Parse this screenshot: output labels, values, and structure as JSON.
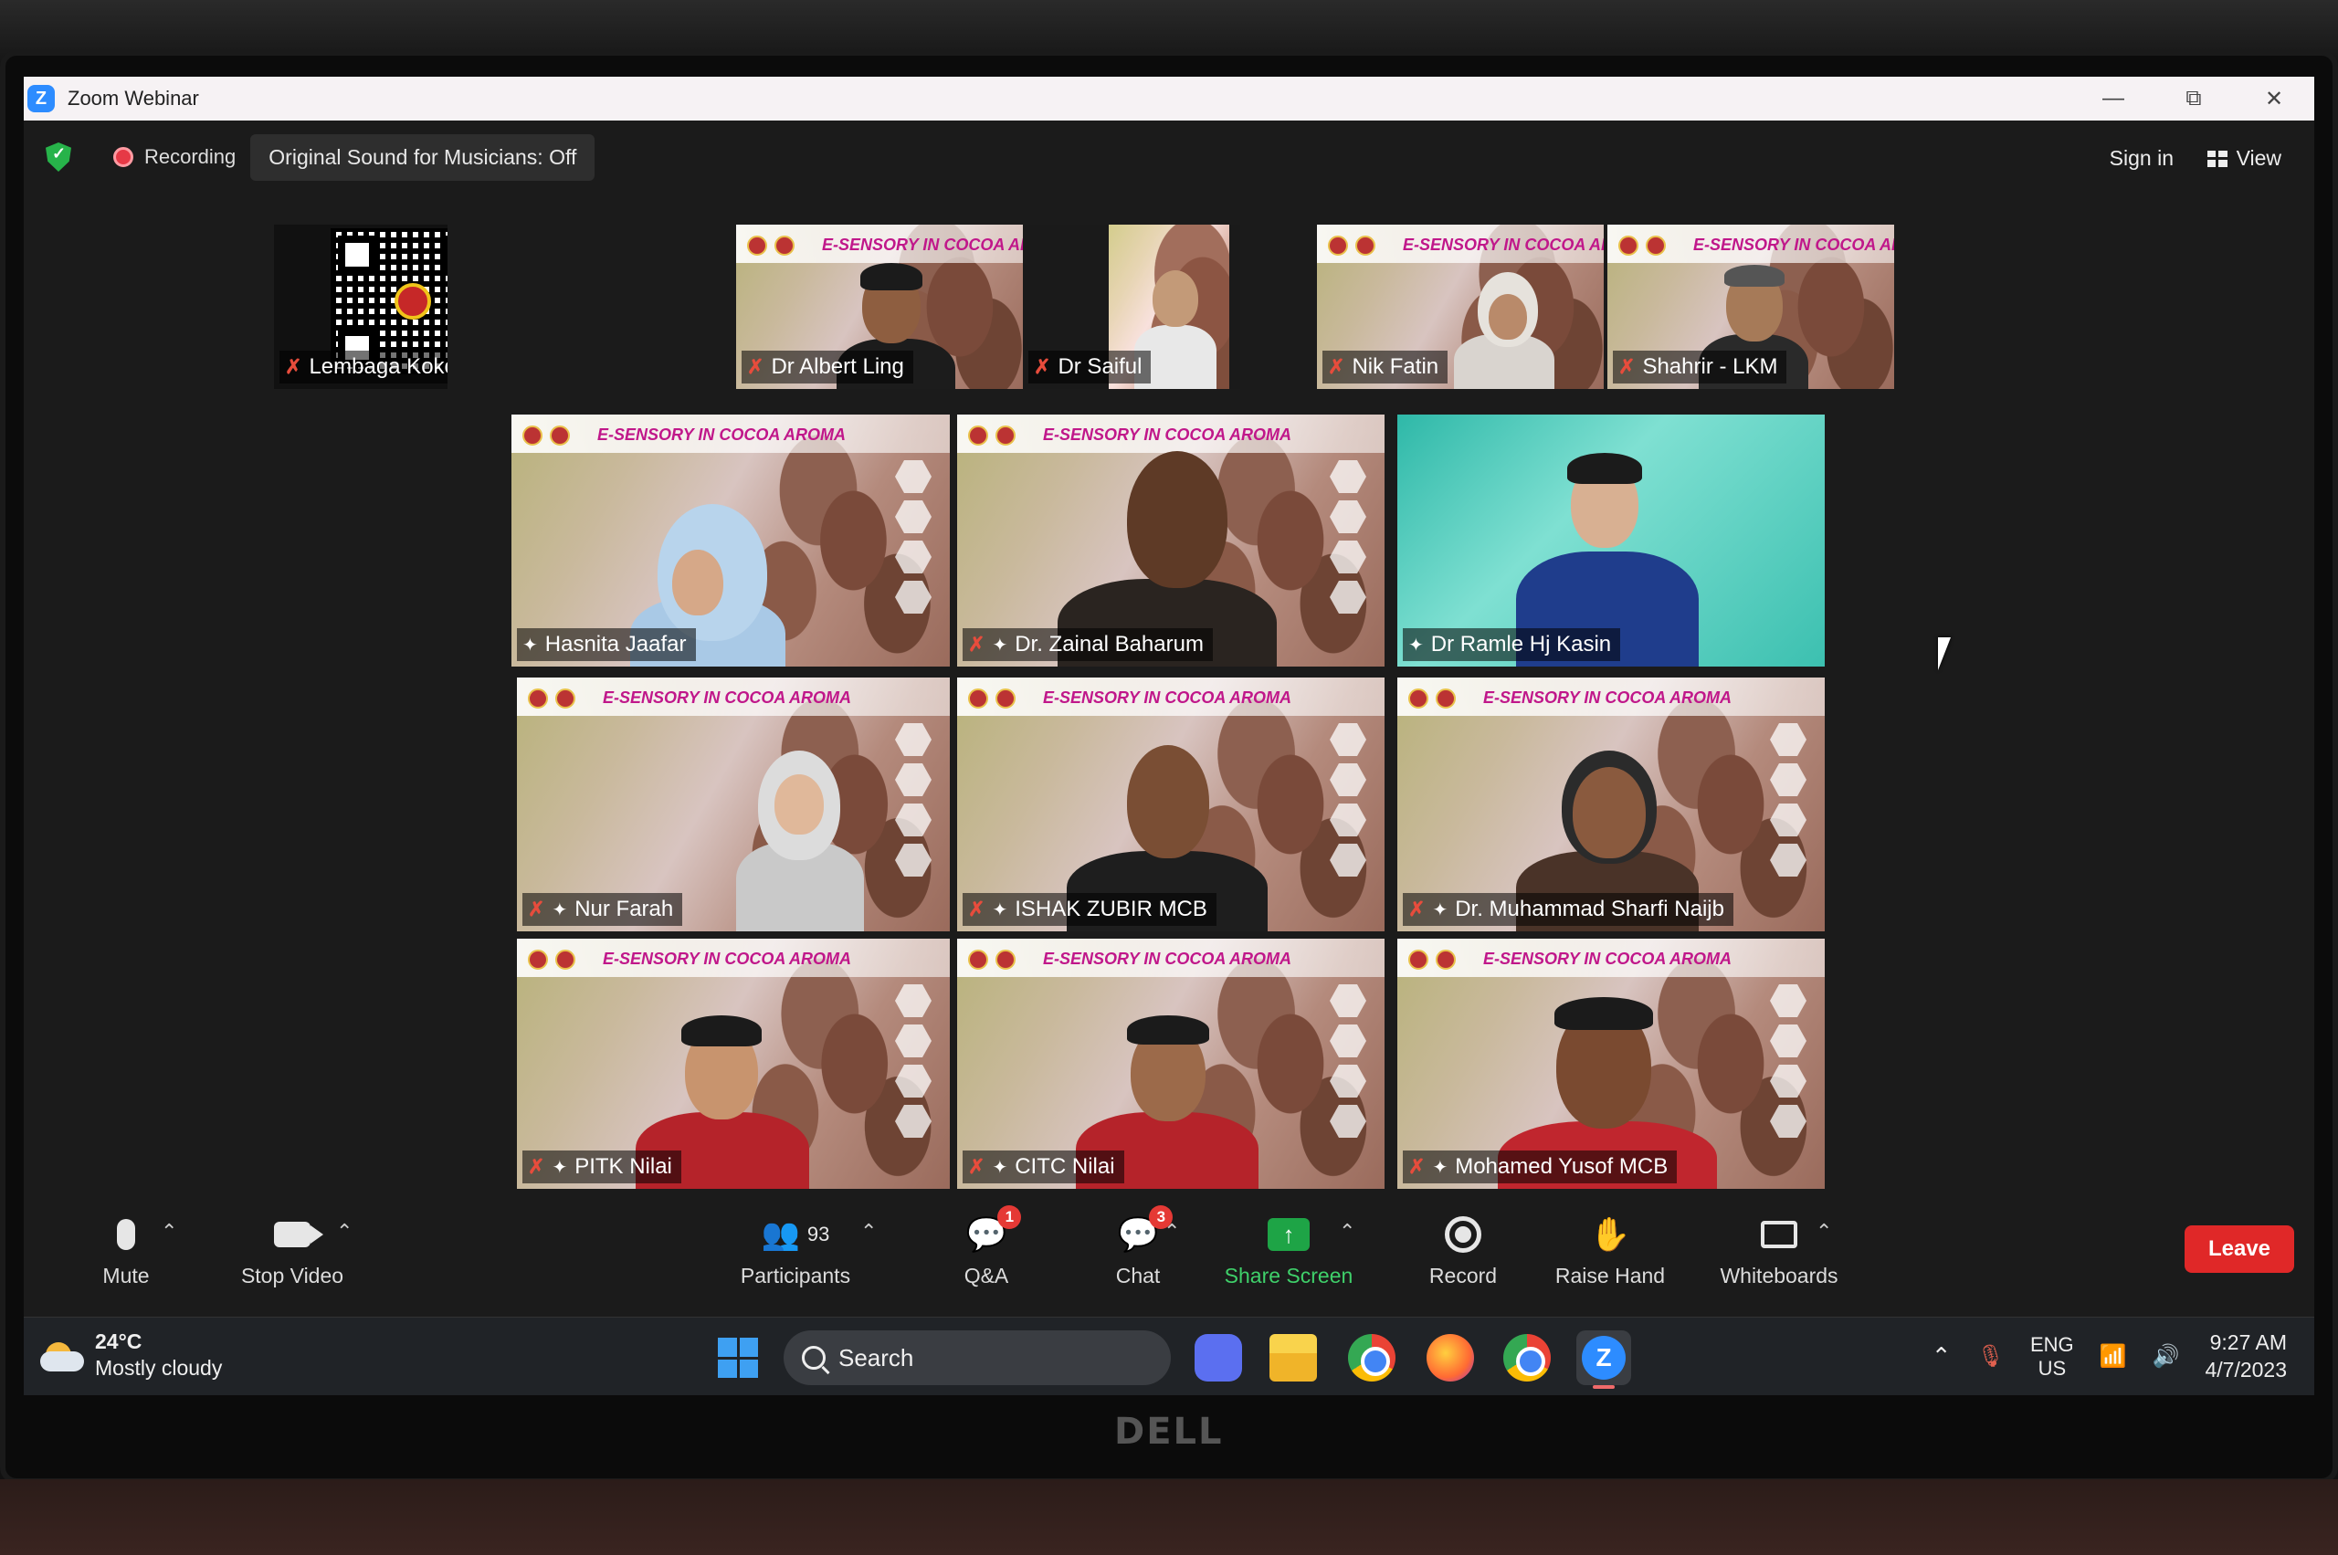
{
  "window": {
    "title": "Zoom Webinar",
    "controls": {
      "minimize": "—",
      "restore": "⧉",
      "close": "✕"
    }
  },
  "status": {
    "recording": "Recording",
    "original_sound": "Original Sound for Musicians: Off",
    "sign_in": "Sign in",
    "view": "View"
  },
  "slide": {
    "title": "E-SENSORY IN COCOA AROMA"
  },
  "gallery_top": [
    {
      "name": "Lembaga Koko Mala...",
      "mic": "muted"
    },
    {
      "name": "Dr Albert Ling",
      "mic": "muted"
    },
    {
      "name": "Dr Saiful",
      "mic": "muted"
    },
    {
      "name": "Nik Fatin",
      "mic": "muted"
    },
    {
      "name": "Shahrir - LKM",
      "mic": "muted"
    }
  ],
  "gallery_main": [
    {
      "name": "Hasnita Jaafar",
      "active": true
    },
    {
      "name": "Dr. Zainal Baharum"
    },
    {
      "name": "Dr Ramle Hj Kasin"
    },
    {
      "name": "Nur Farah"
    },
    {
      "name": "ISHAK ZUBIR MCB"
    },
    {
      "name": "Dr. Muhammad Sharfi Naijb"
    },
    {
      "name": "PITK Nilai"
    },
    {
      "name": "CITC Nilai"
    },
    {
      "name": "Mohamed Yusof MCB"
    }
  ],
  "toolbar": {
    "mute": "Mute",
    "stop_video": "Stop Video",
    "participants": "Participants",
    "participants_count": "93",
    "qa": "Q&A",
    "qa_badge": "1",
    "chat": "Chat",
    "chat_badge": "3",
    "share_screen": "Share Screen",
    "record": "Record",
    "raise_hand": "Raise Hand",
    "whiteboards": "Whiteboards",
    "leave": "Leave"
  },
  "taskbar": {
    "temperature": "24°C",
    "weather": "Mostly cloudy",
    "search": "Search",
    "lang_top": "ENG",
    "lang_bottom": "US",
    "time": "9:27 AM",
    "date": "4/7/2023"
  },
  "monitor_brand": "DELL",
  "colors": {
    "accent": "#2d8cff",
    "leave": "#e02828",
    "share": "#1ea446",
    "active_speaker": "#e3d44a"
  }
}
